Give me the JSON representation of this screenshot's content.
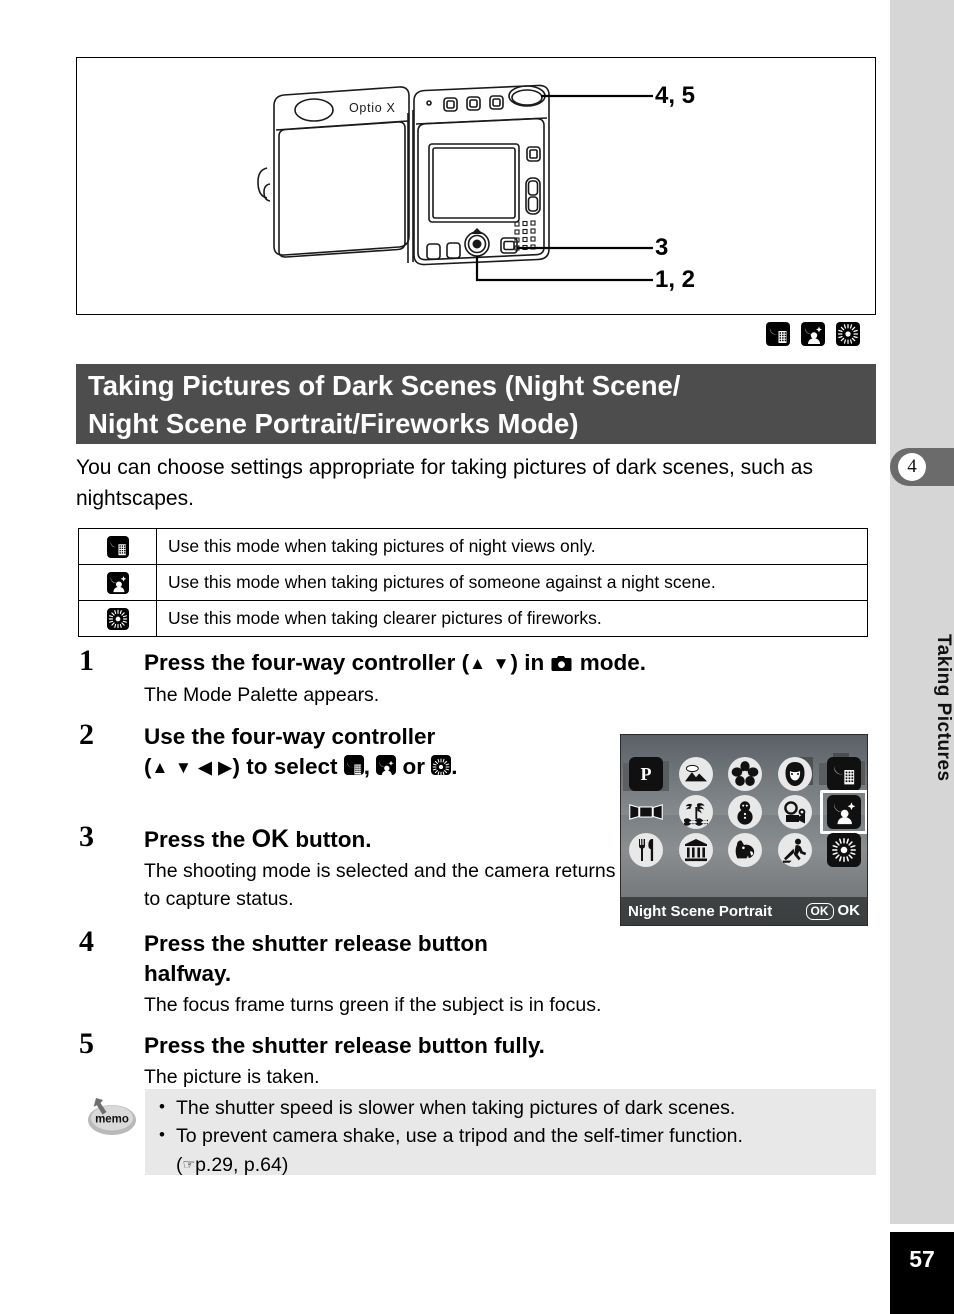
{
  "sidebar": {
    "chapter_number": "4",
    "chapter_title": "Taking Pictures",
    "page_number": "57"
  },
  "figure": {
    "camera_label": "Optio X",
    "callouts": {
      "shutter": "4, 5",
      "ok": "3",
      "four_way": "1, 2"
    }
  },
  "mode_icons": {
    "night_scene": "night-scene-icon",
    "night_scene_portrait": "night-scene-portrait-icon",
    "fireworks": "fireworks-icon"
  },
  "section": {
    "heading_line1": "Taking Pictures of Dark Scenes (Night Scene/",
    "heading_line2": "Night Scene Portrait/Fireworks Mode)",
    "intro": "You can choose settings appropriate for taking pictures of dark scenes, such as nightscapes."
  },
  "mode_table": {
    "rows": [
      {
        "icon": "night-scene-icon",
        "description": "Use this mode when taking pictures of night views only."
      },
      {
        "icon": "night-scene-portrait-icon",
        "description": "Use this mode when taking pictures of someone against a night scene."
      },
      {
        "icon": "fireworks-icon",
        "description": "Use this mode when taking clearer pictures of fireworks."
      }
    ]
  },
  "steps": [
    {
      "number": "1",
      "head_pre": "Press the four-way controller (",
      "head_arrows": "▲ ▼",
      "head_mid": ") in ",
      "head_post": " mode.",
      "body": "The Mode Palette appears."
    },
    {
      "number": "2",
      "head_line1": "Use the four-way controller",
      "head_pre": "(",
      "head_arrows": "▲ ▼ ◀ ▶",
      "head_mid": ") to select ",
      "head_sep": ", ",
      "head_or": " or ",
      "head_post": ".",
      "body": ""
    },
    {
      "number": "3",
      "head_pre": "Press the ",
      "head_ok": "OK",
      "head_post": " button.",
      "body": "The shooting mode is selected and the camera returns to capture status."
    },
    {
      "number": "4",
      "head_line1": "Press the shutter release button",
      "head_line2": "halfway.",
      "body": "The focus frame turns green if the subject is in focus."
    },
    {
      "number": "5",
      "head_line1": "Press the shutter release button fully.",
      "body": "The picture is taken."
    }
  ],
  "lcd": {
    "caption": "Night Scene Portrait",
    "ok_chip": "OK",
    "ok_label": "OK",
    "palette": [
      [
        {
          "name": "program-mode-icon",
          "glyph": "P",
          "style": "square"
        },
        {
          "name": "landscape-mode-icon",
          "glyph": "landscape",
          "style": "circle"
        },
        {
          "name": "flower-mode-icon",
          "glyph": "flower",
          "style": "circle"
        },
        {
          "name": "portrait-mode-icon",
          "glyph": "portrait",
          "style": "circle"
        },
        {
          "name": "night-scene-mode-icon",
          "glyph": "night",
          "style": "square"
        }
      ],
      [
        {
          "name": "panorama-mode-icon",
          "glyph": "panorama",
          "style": "square"
        },
        {
          "name": "surf-snow-mode-icon",
          "glyph": "beach",
          "style": "circle"
        },
        {
          "name": "snow-mode-icon",
          "glyph": "snowman",
          "style": "circle"
        },
        {
          "name": "movie-mode-icon",
          "glyph": "movie",
          "style": "circle"
        },
        {
          "name": "night-scene-portrait-mode-icon",
          "glyph": "nightportrait",
          "style": "square",
          "selected": true
        }
      ],
      [
        {
          "name": "food-mode-icon",
          "glyph": "food",
          "style": "circle"
        },
        {
          "name": "museum-mode-icon",
          "glyph": "museum",
          "style": "circle"
        },
        {
          "name": "pet-mode-icon",
          "glyph": "pet",
          "style": "circle"
        },
        {
          "name": "sport-mode-icon",
          "glyph": "sport",
          "style": "circle"
        },
        {
          "name": "fireworks-mode-icon",
          "glyph": "fireworks",
          "style": "square"
        }
      ]
    ]
  },
  "memo": {
    "label": "memo",
    "items": [
      "The shutter speed is slower when taking pictures of dark scenes.",
      "To prevent camera shake, use a tripod and the self-timer function."
    ],
    "reference": "p.29, p.64"
  }
}
